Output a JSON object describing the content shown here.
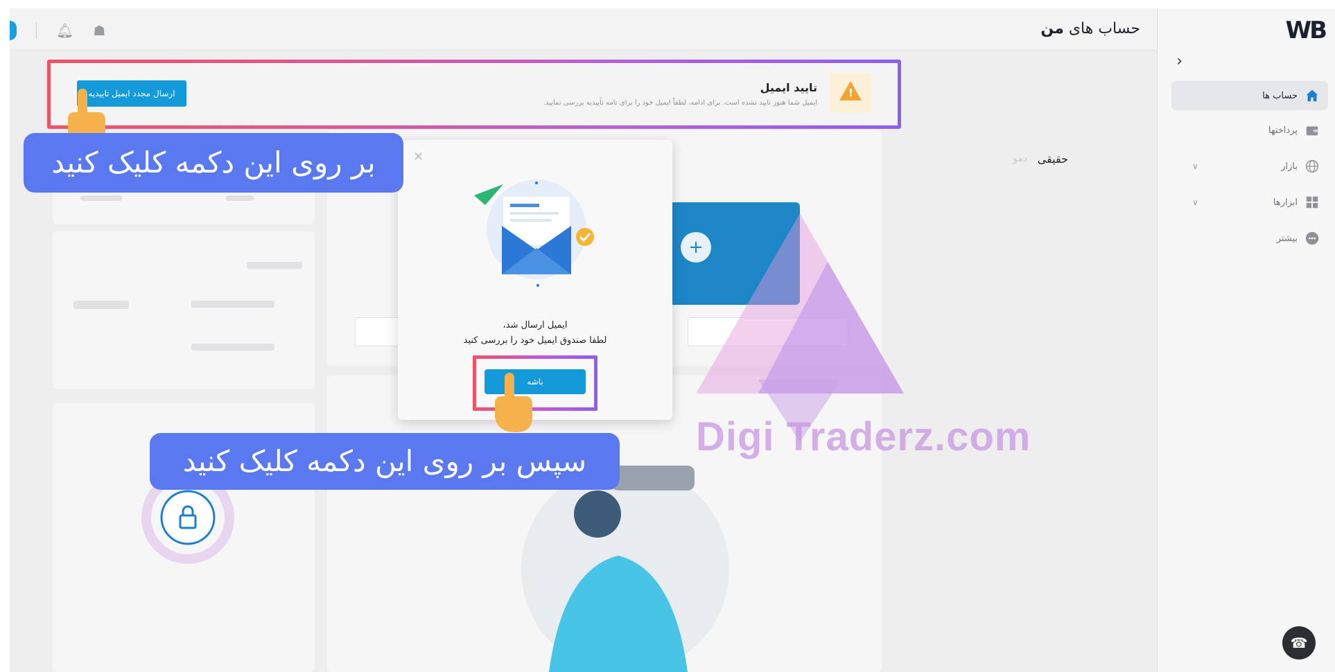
{
  "logo": {
    "text": "WB"
  },
  "header": {
    "title_prefix": "حساب های",
    "title_bold": "من"
  },
  "sidebar": {
    "items": [
      {
        "label": "حساب ها",
        "icon": "home-icon",
        "active": true
      },
      {
        "label": "پرداختها",
        "icon": "wallet-icon"
      },
      {
        "label": "بازار",
        "icon": "globe-icon",
        "has_submenu": true
      },
      {
        "label": "ابزارها",
        "icon": "grid-icon",
        "has_submenu": true
      },
      {
        "label": "بیشتر",
        "icon": "more-icon"
      }
    ]
  },
  "alert": {
    "title": "تایید ایمیل",
    "description": "ایمیل شما هنوز تایید نشده است. برای ادامه، لطفاً ایمیل خود را برای نامه تأییدیه بررسی نمایید.",
    "button_label": "ارسال مجدد ایمیل تاییدیه"
  },
  "tabs": {
    "real": "حقیقی",
    "demo": "دمو"
  },
  "modal": {
    "line1": "ایمیل ارسال شد،",
    "line2": "لطفا صندوق ایمیل خود را بررسی کنید",
    "ok_label": "باشه"
  },
  "callouts": {
    "first": "بر روی این دکمه کلیک کنید",
    "second": "سپس بر روی این دکمه کلیک کنید"
  },
  "watermark": "Digi   Traderz.com",
  "colors": {
    "accent": "#139ad8",
    "callout": "#5a78f0",
    "warning": "#f2a431"
  }
}
